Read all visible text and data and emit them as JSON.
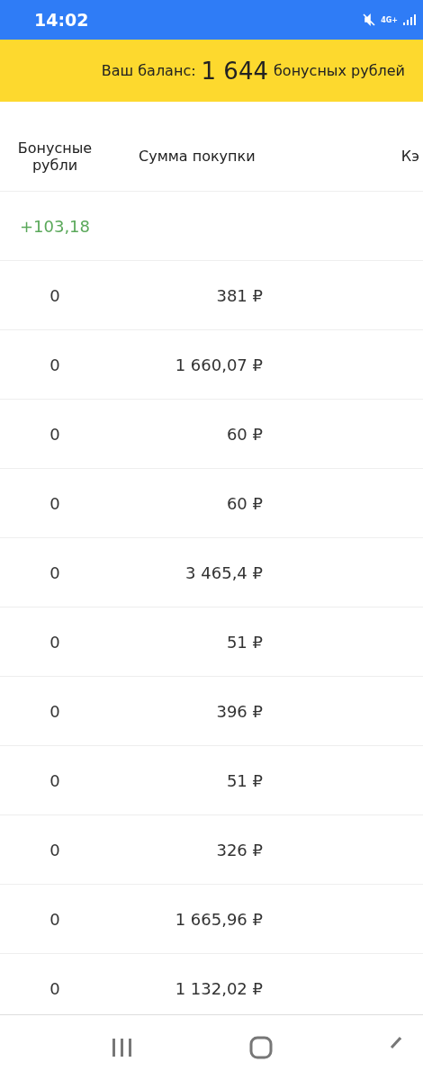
{
  "status_bar": {
    "time": "14:02",
    "network": "4G+"
  },
  "balance": {
    "label": "Ваш баланс:",
    "amount": "1 644",
    "unit": "бонусных рублей"
  },
  "table": {
    "columns": [
      "Бонусные рубли",
      "Сумма покупки",
      "Кэ"
    ],
    "rows": [
      {
        "kind": "credit",
        "bonus": "+103,18",
        "sum": ""
      },
      {
        "kind": "plain",
        "bonus": "0",
        "sum": "381 ₽"
      },
      {
        "kind": "plain",
        "bonus": "0",
        "sum": "1 660,07 ₽"
      },
      {
        "kind": "plain",
        "bonus": "0",
        "sum": "60 ₽"
      },
      {
        "kind": "plain",
        "bonus": "0",
        "sum": "60 ₽"
      },
      {
        "kind": "plain",
        "bonus": "0",
        "sum": "3 465,4 ₽"
      },
      {
        "kind": "plain",
        "bonus": "0",
        "sum": "51 ₽"
      },
      {
        "kind": "plain",
        "bonus": "0",
        "sum": "396 ₽"
      },
      {
        "kind": "plain",
        "bonus": "0",
        "sum": "51 ₽"
      },
      {
        "kind": "plain",
        "bonus": "0",
        "sum": "326 ₽"
      },
      {
        "kind": "plain",
        "bonus": "0",
        "sum": "1 665,96 ₽"
      },
      {
        "kind": "plain",
        "bonus": "0",
        "sum": "1 132,02 ₽"
      }
    ]
  }
}
